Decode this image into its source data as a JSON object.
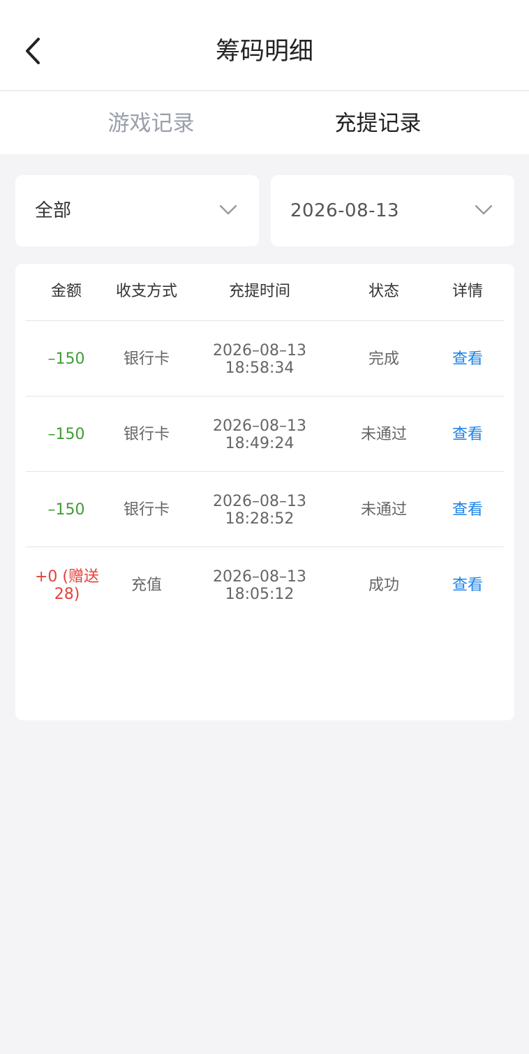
{
  "header": {
    "title": "筹码明细",
    "back_icon": "chevron-left-icon"
  },
  "tabs": [
    {
      "label": "游戏记录",
      "active": false
    },
    {
      "label": "充提记录",
      "active": true
    }
  ],
  "filters": {
    "type": {
      "value": "全部",
      "icon": "chevron-down-icon"
    },
    "date": {
      "value": "2026-08-13",
      "icon": "chevron-down-icon"
    }
  },
  "table": {
    "columns": [
      "金额",
      "收支方式",
      "充提时间",
      "状态",
      "详情"
    ],
    "rows": [
      {
        "amount": "–150",
        "amount_color": "#3f9d35",
        "method": "银行卡",
        "date": "2026–08–13",
        "time": "18:58:34",
        "status": "完成",
        "detail": "查看"
      },
      {
        "amount": "–150",
        "amount_color": "#3f9d35",
        "method": "银行卡",
        "date": "2026–08–13",
        "time": "18:49:24",
        "status": "未通过",
        "detail": "查看"
      },
      {
        "amount": "–150",
        "amount_color": "#3f9d35",
        "method": "银行卡",
        "date": "2026–08–13",
        "time": "18:28:52",
        "status": "未通过",
        "detail": "查看"
      },
      {
        "amount_line1": "+0 (赠送",
        "amount_line2": "28)",
        "amount_color": "#e5403a",
        "method": "充值",
        "date": "2026–08–13",
        "time": "18:05:12",
        "status": "成功",
        "detail": "查看"
      }
    ]
  },
  "colors": {
    "accent": "#1c83e8",
    "negative": "#3f9d35",
    "positive": "#e5403a",
    "background": "#f4f4f6"
  }
}
